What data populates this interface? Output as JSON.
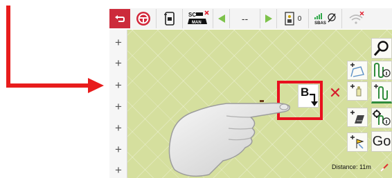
{
  "toolbar": {
    "center_value": "--",
    "count": "0",
    "sbas_label": "SBAS"
  },
  "lightbar_colors": [
    "#e83030",
    "#f3d21b",
    "#33b24b",
    "#33b24b",
    "#f3d21b",
    "#e83030"
  ],
  "map": {
    "b_button_label": "B",
    "go_label": "Go",
    "distance_text": "Distance: 11m"
  },
  "left_column": {
    "plus_symbol": "+"
  },
  "icons": {
    "back": "back-arrow-icon",
    "steer": "steering-wheel-icon",
    "phone": "phone-vehicle-icon",
    "sc_man": "sc-manual-icon",
    "search": "magnifier-icon"
  },
  "colors": {
    "accent_red": "#cc2b3b",
    "map_green": "#d5df9e",
    "highlight_red": "#e8101e"
  }
}
